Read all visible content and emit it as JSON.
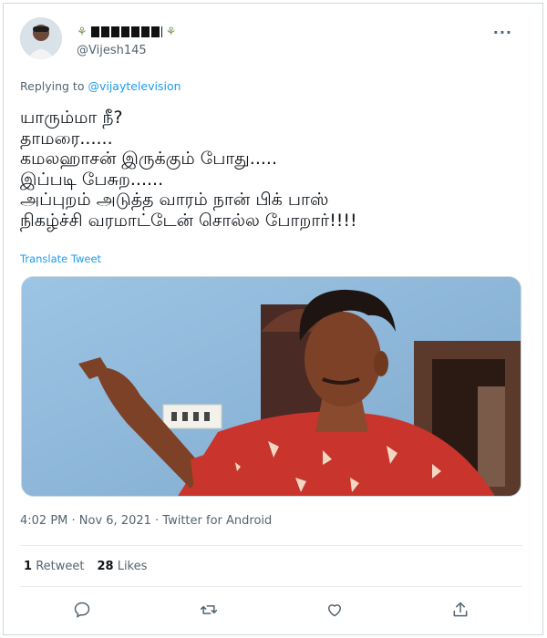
{
  "tweet": {
    "display_name_leaf_left": "⚘",
    "display_name_leaf_right": "⚘",
    "handle": "@Vijesh145",
    "more_icon": "···",
    "replying_prefix": "Replying to",
    "replying_to": "@vijaytelevision",
    "text_lines": [
      "யாரும்மா நீ?",
      "தாமரை......",
      "கமலஹாசன் இருக்கும் போது.....",
      "இப்படி பேசுற......",
      "அப்புறம் அடுத்த வாரம் நான் பிக் பாஸ்",
      "நிகழ்ச்சி வரமாட்டேன் சொல்ல போறார்!!!!"
    ],
    "translate_label": "Translate Tweet",
    "timestamp": "4:02 PM · Nov 6, 2021 · Twitter for Android",
    "retweets_count": "1",
    "retweets_label": "Retweet",
    "likes_count": "28",
    "likes_label": "Likes"
  },
  "icons": {
    "reply": "reply-icon",
    "retweet": "retweet-icon",
    "like": "heart-icon",
    "share": "share-icon"
  },
  "colors": {
    "accent": "#1d9bf0",
    "secondary_text": "#536471",
    "wall": "#8fb8da",
    "shirt": "#c9342d"
  }
}
